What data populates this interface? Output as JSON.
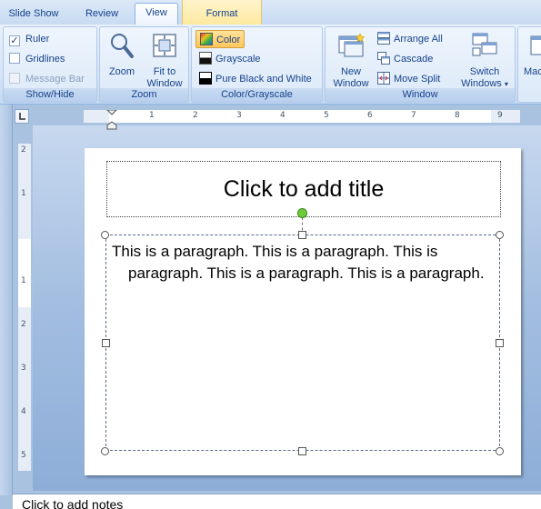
{
  "tabs": [
    {
      "label": "Slide Show"
    },
    {
      "label": "Review"
    },
    {
      "label": "View"
    },
    {
      "label": "Format"
    }
  ],
  "ribbon": {
    "show_hide": {
      "label": "Show/Hide",
      "ruler": "Ruler",
      "gridlines": "Gridlines",
      "message_bar": "Message Bar"
    },
    "zoom": {
      "label": "Zoom",
      "zoom_btn": "Zoom",
      "fit_line1": "Fit to",
      "fit_line2": "Window"
    },
    "color_grayscale": {
      "label": "Color/Grayscale",
      "color": "Color",
      "grayscale": "Grayscale",
      "pure_bw": "Pure Black and White"
    },
    "window": {
      "label": "Window",
      "new_line1": "New",
      "new_line2": "Window",
      "arrange_all": "Arrange All",
      "cascade": "Cascade",
      "move_split": "Move Split",
      "switch_line1": "Switch",
      "switch_line2": "Windows"
    },
    "macros_partial": "Mac"
  },
  "ruler": {
    "h_numbers": [
      "1",
      "2",
      "3",
      "4",
      "5",
      "6",
      "7",
      "8",
      "9"
    ],
    "v_numbers": [
      "2",
      "1",
      "1",
      "2",
      "3",
      "4",
      "5"
    ]
  },
  "slide": {
    "title_placeholder": "Click to add title",
    "body_text": "This is a paragraph. This is a paragraph. This is paragraph. This is a paragraph. This is a paragraph."
  },
  "notes": {
    "placeholder": "Click to add notes"
  },
  "colors": {
    "ribbon_text": "#15428b",
    "active_color_button": "#ffc65a",
    "rotate_handle": "#6ecc3a"
  }
}
